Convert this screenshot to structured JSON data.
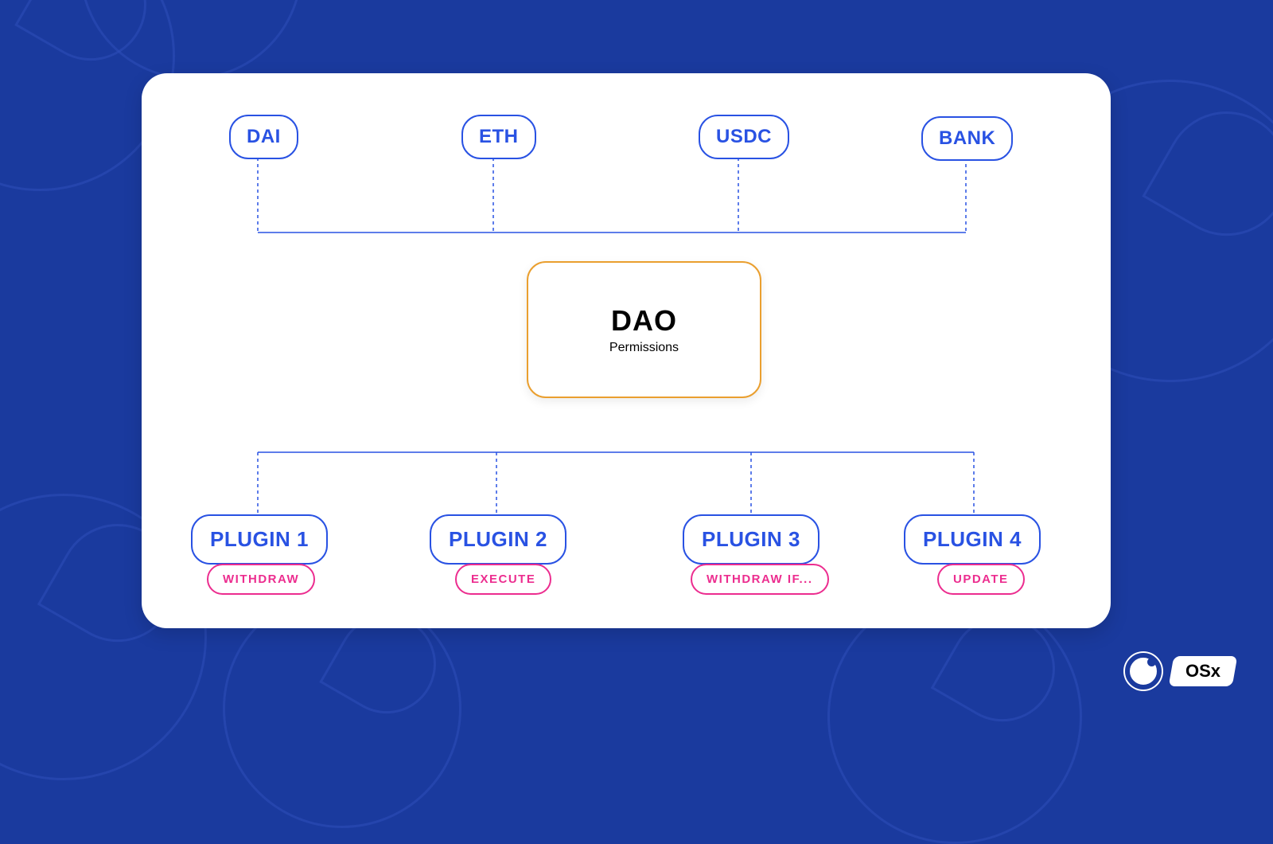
{
  "assets": [
    {
      "label": "DAI"
    },
    {
      "label": "ETH"
    },
    {
      "label": "USDC"
    },
    {
      "label": "BANK"
    }
  ],
  "center": {
    "title": "DAO",
    "subtitle": "Permissions"
  },
  "plugins": [
    {
      "label": "PLUGIN 1",
      "action": "WITHDRAW"
    },
    {
      "label": "PLUGIN 2",
      "action": "EXECUTE"
    },
    {
      "label": "PLUGIN 3",
      "action": "WITHDRAW IF..."
    },
    {
      "label": "PLUGIN 4",
      "action": "UPDATE"
    }
  ],
  "brand": {
    "name": "OSx"
  },
  "colors": {
    "bg": "#1a3a9e",
    "primary": "#2952e3",
    "accent_orange": "#ea9f2f",
    "accent_pink": "#ec2d8f"
  }
}
